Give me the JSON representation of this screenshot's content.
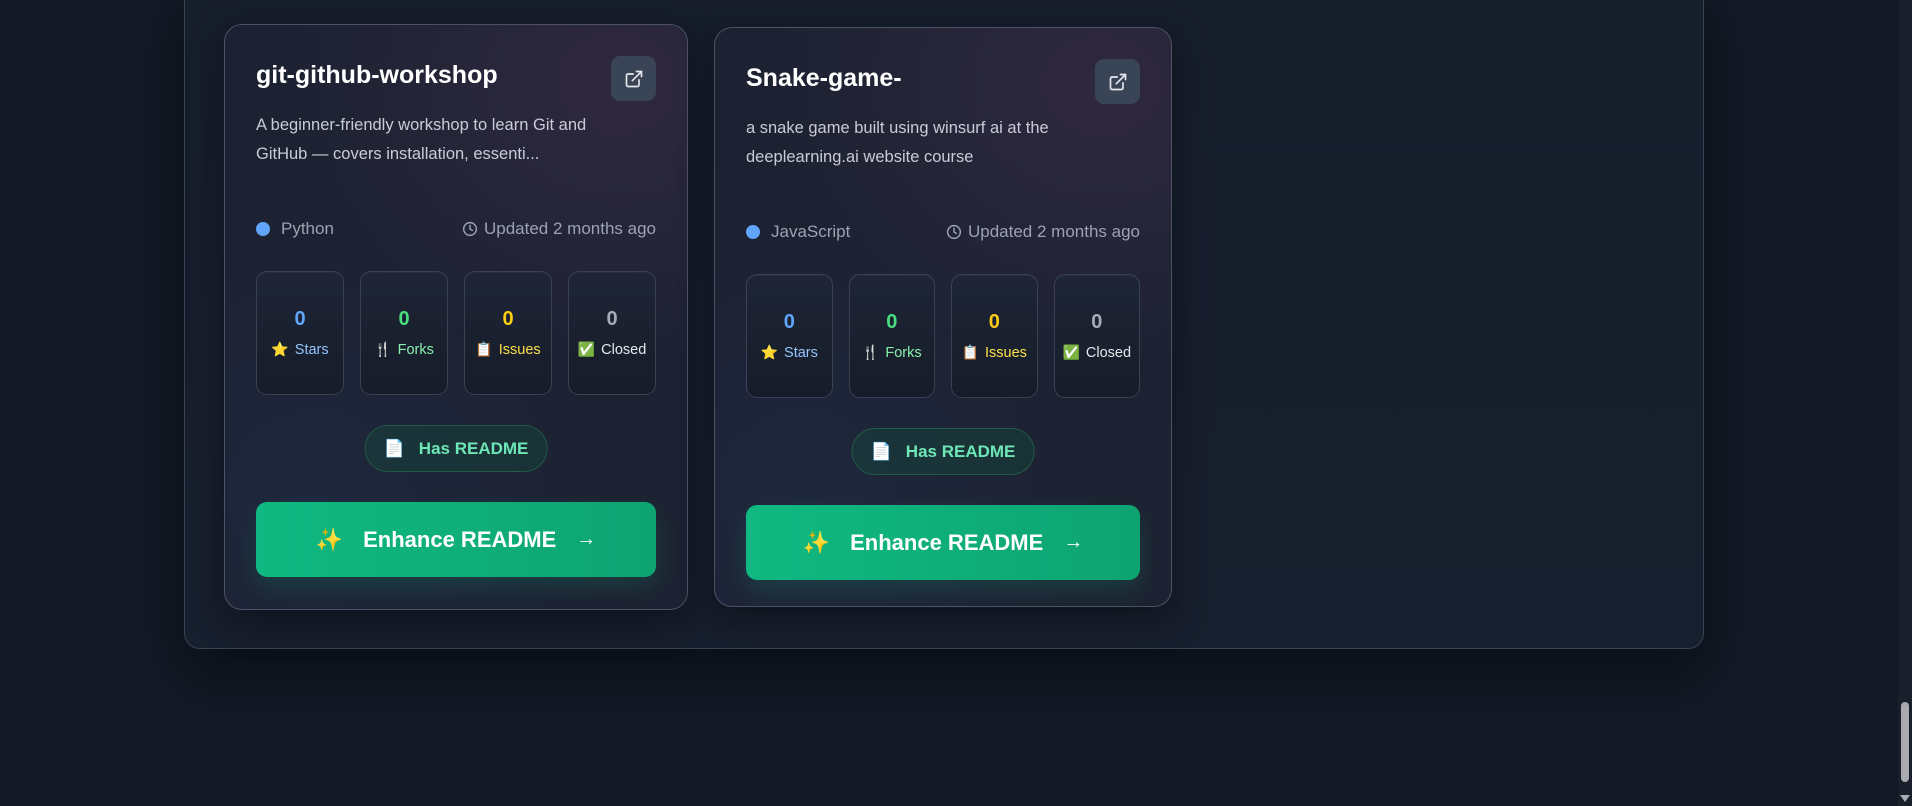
{
  "repos": [
    {
      "name": "git-github-workshop",
      "description": "A beginner-friendly workshop to learn Git and GitHub — covers installation, essenti...",
      "language": "Python",
      "language_color": "#60a5fa",
      "updated": "Updated 2 months ago",
      "stats": {
        "stars": {
          "value": "0",
          "label": "Stars",
          "icon": "⭐"
        },
        "forks": {
          "value": "0",
          "label": "Forks",
          "icon": "🍴"
        },
        "issues": {
          "value": "0",
          "label": "Issues",
          "icon": "📋"
        },
        "closed": {
          "value": "0",
          "label": "Closed",
          "icon": "✅"
        }
      },
      "readme_badge": "Has README",
      "readme_icon": "📄",
      "enhance_label": "Enhance README",
      "enhance_icon": "✨",
      "enhance_arrow": "→"
    },
    {
      "name": "Snake-game-",
      "description": "a snake game built using winsurf ai at the deeplearning.ai website course",
      "language": "JavaScript",
      "language_color": "#60a5fa",
      "updated": "Updated 2 months ago",
      "stats": {
        "stars": {
          "value": "0",
          "label": "Stars",
          "icon": "⭐"
        },
        "forks": {
          "value": "0",
          "label": "Forks",
          "icon": "🍴"
        },
        "issues": {
          "value": "0",
          "label": "Issues",
          "icon": "📋"
        },
        "closed": {
          "value": "0",
          "label": "Closed",
          "icon": "✅"
        }
      },
      "readme_badge": "Has README",
      "readme_icon": "📄",
      "enhance_label": "Enhance README",
      "enhance_icon": "✨",
      "enhance_arrow": "→"
    }
  ],
  "colors": {
    "background": "#131a26",
    "card": "#1d2232",
    "accent_green": "#10b981",
    "stars": "#60a5fa",
    "forks": "#4ade80",
    "issues": "#facc15",
    "closed": "#a6acb8"
  }
}
